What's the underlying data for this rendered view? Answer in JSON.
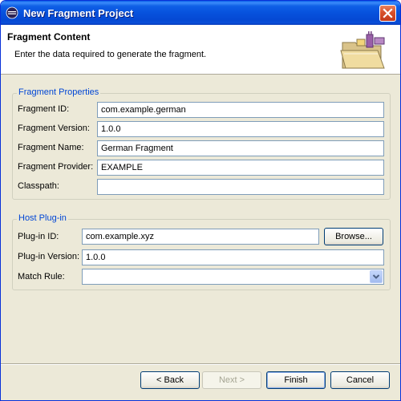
{
  "window": {
    "title": "New Fragment Project"
  },
  "banner": {
    "title": "Fragment Content",
    "description": "Enter the data required to generate the fragment."
  },
  "fragment_properties": {
    "group_title": "Fragment Properties",
    "fields": [
      {
        "label": "Fragment ID:",
        "value": "com.example.german"
      },
      {
        "label": "Fragment Version:",
        "value": "1.0.0"
      },
      {
        "label": "Fragment Name:",
        "value": "German Fragment"
      },
      {
        "label": "Fragment Provider:",
        "value": "EXAMPLE"
      },
      {
        "label": "Classpath:",
        "value": ""
      }
    ]
  },
  "host_plugin": {
    "group_title": "Host Plug-in",
    "plugin_id_label": "Plug-in ID:",
    "plugin_id_value": "com.example.xyz",
    "browse_label": "Browse...",
    "plugin_version_label": "Plug-in Version:",
    "plugin_version_value": "1.0.0",
    "match_rule_label": "Match Rule:",
    "match_rule_value": ""
  },
  "buttons": {
    "back": "< Back",
    "next": "Next >",
    "finish": "Finish",
    "cancel": "Cancel"
  },
  "colors": {
    "titlebar": "#0752dd",
    "group_title": "#0046d5",
    "dialog_bg": "#ece9d8"
  },
  "icons": {
    "app": "eclipse-icon",
    "close": "close-icon",
    "banner": "fragment-folder-icon",
    "combo": "chevron-down-icon"
  }
}
